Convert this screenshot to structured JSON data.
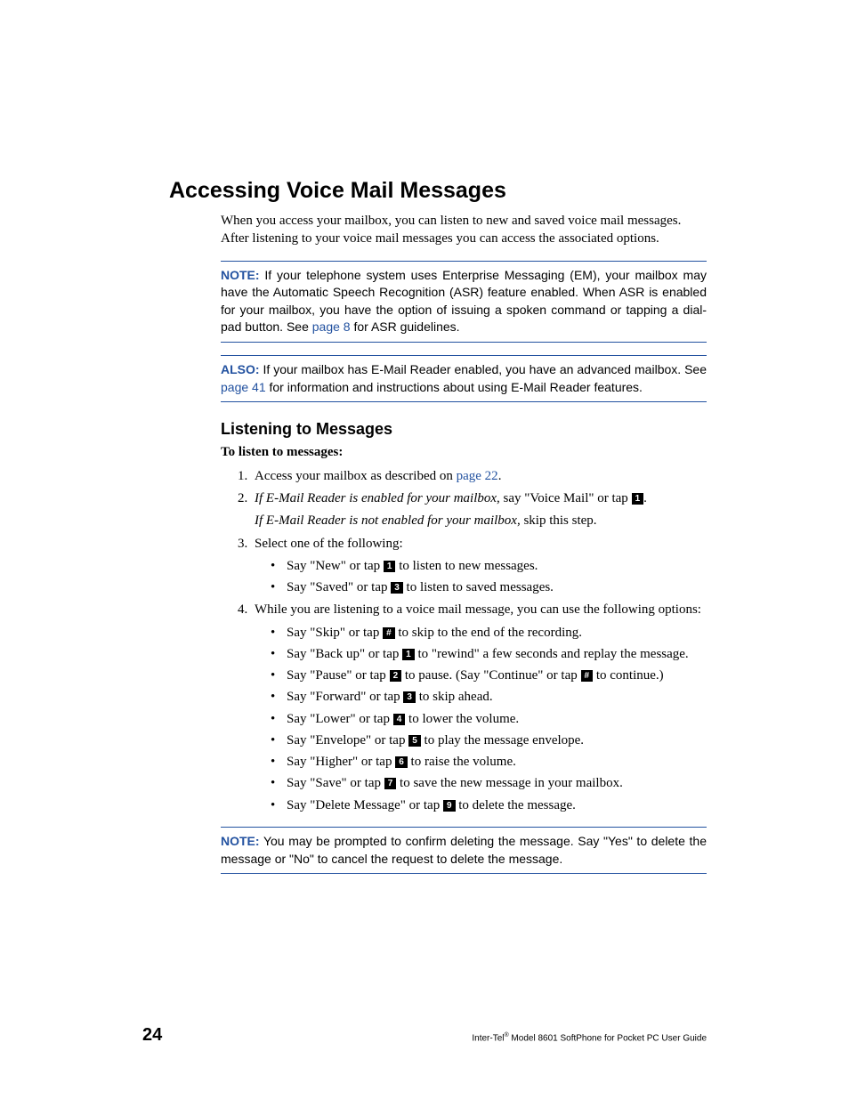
{
  "h1": "Accessing Voice Mail Messages",
  "intro": "When you access your mailbox, you can listen to new and saved voice mail messages. After listening to your voice mail messages you can access the associated options.",
  "note1": {
    "label": "NOTE:",
    "pre": " If your telephone system uses Enterprise Messaging (EM), your mailbox may have the Automatic Speech Recognition (ASR) feature enabled. When ASR is enabled for your mailbox, you have the option of issuing a spoken command or tapping a dial-pad button. See ",
    "link": "page 8",
    "post": " for ASR guidelines."
  },
  "note2": {
    "label": "ALSO:",
    "pre": " If your mailbox has E-Mail Reader enabled, you have an advanced mailbox. See ",
    "link": "page 41",
    "post": " for information and instructions about using E-Mail Reader features."
  },
  "h2": "Listening to Messages",
  "lead": "To listen to messages:",
  "steps": {
    "s1": {
      "pre": "Access your mailbox as described on ",
      "link": "page 22",
      "post": "."
    },
    "s2": {
      "em": "If E-Mail Reader is enabled for your mailbox",
      "mid": ", say \"Voice Mail\" or tap ",
      "key": "1",
      "post": ".",
      "line2_em": "If E-Mail Reader is not enabled for your mailbox",
      "line2_post": ", skip this step."
    },
    "s3": {
      "intro": "Select one of the following:",
      "a": {
        "pre": "Say \"New\" or tap ",
        "key": "1",
        "post": " to listen to new messages."
      },
      "b": {
        "pre": "Say \"Saved\" or tap ",
        "key": "3",
        "post": " to listen to saved messages."
      }
    },
    "s4": {
      "intro": "While you are listening to a voice mail message, you can use the following options:",
      "a": {
        "pre": "Say \"Skip\" or tap ",
        "key": "#",
        "post": " to skip to the end of the recording."
      },
      "b": {
        "pre": "Say \"Back up\" or tap ",
        "key": "1",
        "post": " to \"rewind\" a few seconds and replay the message."
      },
      "c": {
        "pre": "Say \"Pause\" or tap ",
        "key": "2",
        "mid": " to pause. (Say \"Continue\" or tap ",
        "key2": "#",
        "post": " to continue.)"
      },
      "d": {
        "pre": "Say \"Forward\" or tap ",
        "key": "3",
        "post": " to skip ahead."
      },
      "e": {
        "pre": "Say \"Lower\" or tap ",
        "key": "4",
        "post": " to lower the volume."
      },
      "f": {
        "pre": "Say \"Envelope\" or tap ",
        "key": "5",
        "post": " to play the message envelope."
      },
      "g": {
        "pre": "Say \"Higher\" or tap ",
        "key": "6",
        "post": " to raise the volume."
      },
      "h": {
        "pre": "Say \"Save\" or tap ",
        "key": "7",
        "post": " to save the new message in your mailbox."
      },
      "i": {
        "pre": "Say \"Delete Message\" or tap ",
        "key": "9",
        "post": " to delete the message."
      }
    }
  },
  "note3": {
    "label": "NOTE:",
    "text": " You may be prompted to confirm deleting the message. Say \"Yes\" to delete the message or \"No\" to cancel the request to delete the message."
  },
  "footer": {
    "pagenum": "24",
    "pre": "Inter-Tel",
    "sup": "®",
    "post": " Model 8601 SoftPhone for Pocket PC User Guide"
  }
}
